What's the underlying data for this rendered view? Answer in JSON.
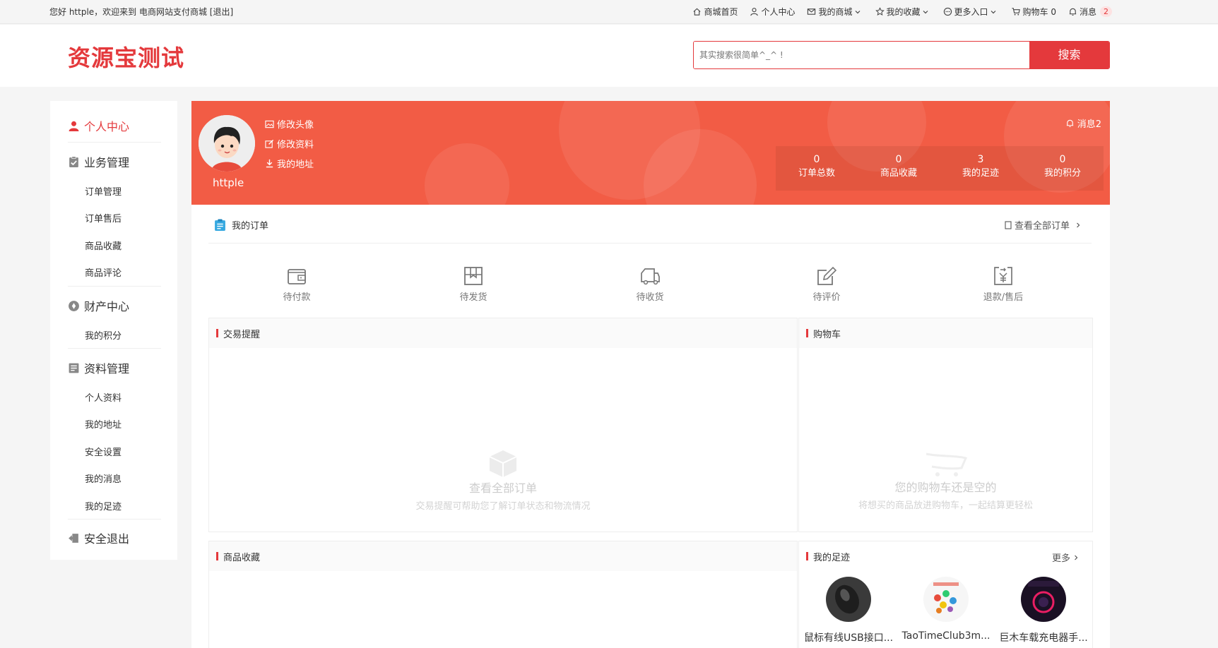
{
  "topbar": {
    "greeting": "您好 httple，欢迎来到 电商网站支付商城 [退出]",
    "nav": {
      "home": "商城首页",
      "center": "个人中心",
      "mall": "我的商城",
      "fav": "我的收藏",
      "more": "更多入口",
      "cart": "购物车 0",
      "msg": "消息",
      "msg_count": "2"
    }
  },
  "header": {
    "logo": "资源宝测试",
    "search_placeholder": "其实搜索很简单^_^ !",
    "search_button": "搜索"
  },
  "sidebar": {
    "center": "个人中心",
    "business": "业务管理",
    "business_items": [
      "订单管理",
      "订单售后",
      "商品收藏",
      "商品评论"
    ],
    "assets": "财产中心",
    "assets_items": [
      "我的积分"
    ],
    "profile": "资料管理",
    "profile_items": [
      "个人资料",
      "我的地址",
      "安全设置",
      "我的消息",
      "我的足迹"
    ],
    "logout": "安全退出"
  },
  "banner": {
    "username": "httple",
    "links": [
      "修改头像",
      "修改资料",
      "我的地址"
    ],
    "message": "消息2",
    "stats": [
      {
        "value": "0",
        "label": "订单总数"
      },
      {
        "value": "0",
        "label": "商品收藏"
      },
      {
        "value": "3",
        "label": "我的足迹"
      },
      {
        "value": "0",
        "label": "我的积分"
      }
    ]
  },
  "orders": {
    "title": "我的订单",
    "view_all": "查看全部订单",
    "statuses": [
      "待付款",
      "待发货",
      "待收货",
      "待评价",
      "退款/售后"
    ]
  },
  "trade": {
    "title": "交易提醒",
    "empty_title": "查看全部订单",
    "empty_desc": "交易提醒可帮助您了解订单状态和物流情况"
  },
  "cart": {
    "title": "购物车",
    "empty_title": "您的购物车还是空的",
    "empty_desc": "将想买的商品放进购物车，一起结算更轻松"
  },
  "favorites": {
    "title": "商品收藏"
  },
  "footprints": {
    "title": "我的足迹",
    "more": "更多",
    "items": [
      {
        "name": "鼠标有线USB接口..."
      },
      {
        "name": "TaoTimeClub3m..."
      },
      {
        "name": "巨木车载充电器手..."
      }
    ]
  },
  "colors": {
    "accent": "#e4393c",
    "banner": "#f25c45"
  }
}
